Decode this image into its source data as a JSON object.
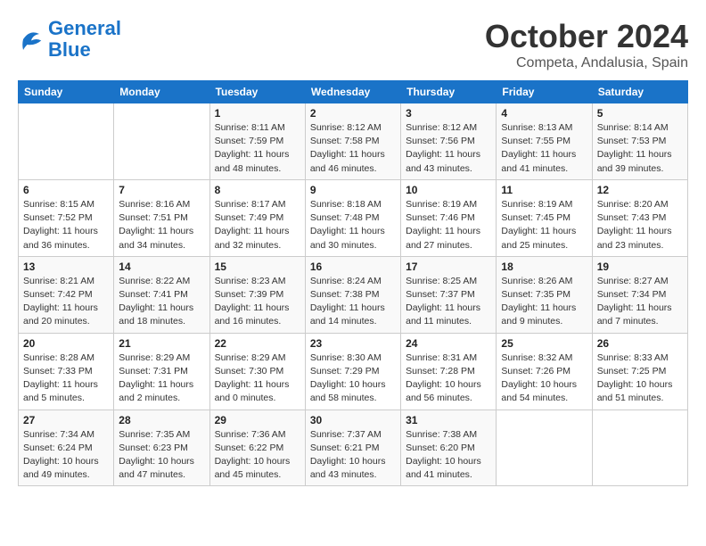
{
  "header": {
    "logo_line1": "General",
    "logo_line2": "Blue",
    "month": "October 2024",
    "location": "Competa, Andalusia, Spain"
  },
  "days_of_week": [
    "Sunday",
    "Monday",
    "Tuesday",
    "Wednesday",
    "Thursday",
    "Friday",
    "Saturday"
  ],
  "weeks": [
    [
      {
        "day": "",
        "info": ""
      },
      {
        "day": "",
        "info": ""
      },
      {
        "day": "1",
        "info": "Sunrise: 8:11 AM\nSunset: 7:59 PM\nDaylight: 11 hours and 48 minutes."
      },
      {
        "day": "2",
        "info": "Sunrise: 8:12 AM\nSunset: 7:58 PM\nDaylight: 11 hours and 46 minutes."
      },
      {
        "day": "3",
        "info": "Sunrise: 8:12 AM\nSunset: 7:56 PM\nDaylight: 11 hours and 43 minutes."
      },
      {
        "day": "4",
        "info": "Sunrise: 8:13 AM\nSunset: 7:55 PM\nDaylight: 11 hours and 41 minutes."
      },
      {
        "day": "5",
        "info": "Sunrise: 8:14 AM\nSunset: 7:53 PM\nDaylight: 11 hours and 39 minutes."
      }
    ],
    [
      {
        "day": "6",
        "info": "Sunrise: 8:15 AM\nSunset: 7:52 PM\nDaylight: 11 hours and 36 minutes."
      },
      {
        "day": "7",
        "info": "Sunrise: 8:16 AM\nSunset: 7:51 PM\nDaylight: 11 hours and 34 minutes."
      },
      {
        "day": "8",
        "info": "Sunrise: 8:17 AM\nSunset: 7:49 PM\nDaylight: 11 hours and 32 minutes."
      },
      {
        "day": "9",
        "info": "Sunrise: 8:18 AM\nSunset: 7:48 PM\nDaylight: 11 hours and 30 minutes."
      },
      {
        "day": "10",
        "info": "Sunrise: 8:19 AM\nSunset: 7:46 PM\nDaylight: 11 hours and 27 minutes."
      },
      {
        "day": "11",
        "info": "Sunrise: 8:19 AM\nSunset: 7:45 PM\nDaylight: 11 hours and 25 minutes."
      },
      {
        "day": "12",
        "info": "Sunrise: 8:20 AM\nSunset: 7:43 PM\nDaylight: 11 hours and 23 minutes."
      }
    ],
    [
      {
        "day": "13",
        "info": "Sunrise: 8:21 AM\nSunset: 7:42 PM\nDaylight: 11 hours and 20 minutes."
      },
      {
        "day": "14",
        "info": "Sunrise: 8:22 AM\nSunset: 7:41 PM\nDaylight: 11 hours and 18 minutes."
      },
      {
        "day": "15",
        "info": "Sunrise: 8:23 AM\nSunset: 7:39 PM\nDaylight: 11 hours and 16 minutes."
      },
      {
        "day": "16",
        "info": "Sunrise: 8:24 AM\nSunset: 7:38 PM\nDaylight: 11 hours and 14 minutes."
      },
      {
        "day": "17",
        "info": "Sunrise: 8:25 AM\nSunset: 7:37 PM\nDaylight: 11 hours and 11 minutes."
      },
      {
        "day": "18",
        "info": "Sunrise: 8:26 AM\nSunset: 7:35 PM\nDaylight: 11 hours and 9 minutes."
      },
      {
        "day": "19",
        "info": "Sunrise: 8:27 AM\nSunset: 7:34 PM\nDaylight: 11 hours and 7 minutes."
      }
    ],
    [
      {
        "day": "20",
        "info": "Sunrise: 8:28 AM\nSunset: 7:33 PM\nDaylight: 11 hours and 5 minutes."
      },
      {
        "day": "21",
        "info": "Sunrise: 8:29 AM\nSunset: 7:31 PM\nDaylight: 11 hours and 2 minutes."
      },
      {
        "day": "22",
        "info": "Sunrise: 8:29 AM\nSunset: 7:30 PM\nDaylight: 11 hours and 0 minutes."
      },
      {
        "day": "23",
        "info": "Sunrise: 8:30 AM\nSunset: 7:29 PM\nDaylight: 10 hours and 58 minutes."
      },
      {
        "day": "24",
        "info": "Sunrise: 8:31 AM\nSunset: 7:28 PM\nDaylight: 10 hours and 56 minutes."
      },
      {
        "day": "25",
        "info": "Sunrise: 8:32 AM\nSunset: 7:26 PM\nDaylight: 10 hours and 54 minutes."
      },
      {
        "day": "26",
        "info": "Sunrise: 8:33 AM\nSunset: 7:25 PM\nDaylight: 10 hours and 51 minutes."
      }
    ],
    [
      {
        "day": "27",
        "info": "Sunrise: 7:34 AM\nSunset: 6:24 PM\nDaylight: 10 hours and 49 minutes."
      },
      {
        "day": "28",
        "info": "Sunrise: 7:35 AM\nSunset: 6:23 PM\nDaylight: 10 hours and 47 minutes."
      },
      {
        "day": "29",
        "info": "Sunrise: 7:36 AM\nSunset: 6:22 PM\nDaylight: 10 hours and 45 minutes."
      },
      {
        "day": "30",
        "info": "Sunrise: 7:37 AM\nSunset: 6:21 PM\nDaylight: 10 hours and 43 minutes."
      },
      {
        "day": "31",
        "info": "Sunrise: 7:38 AM\nSunset: 6:20 PM\nDaylight: 10 hours and 41 minutes."
      },
      {
        "day": "",
        "info": ""
      },
      {
        "day": "",
        "info": ""
      }
    ]
  ]
}
